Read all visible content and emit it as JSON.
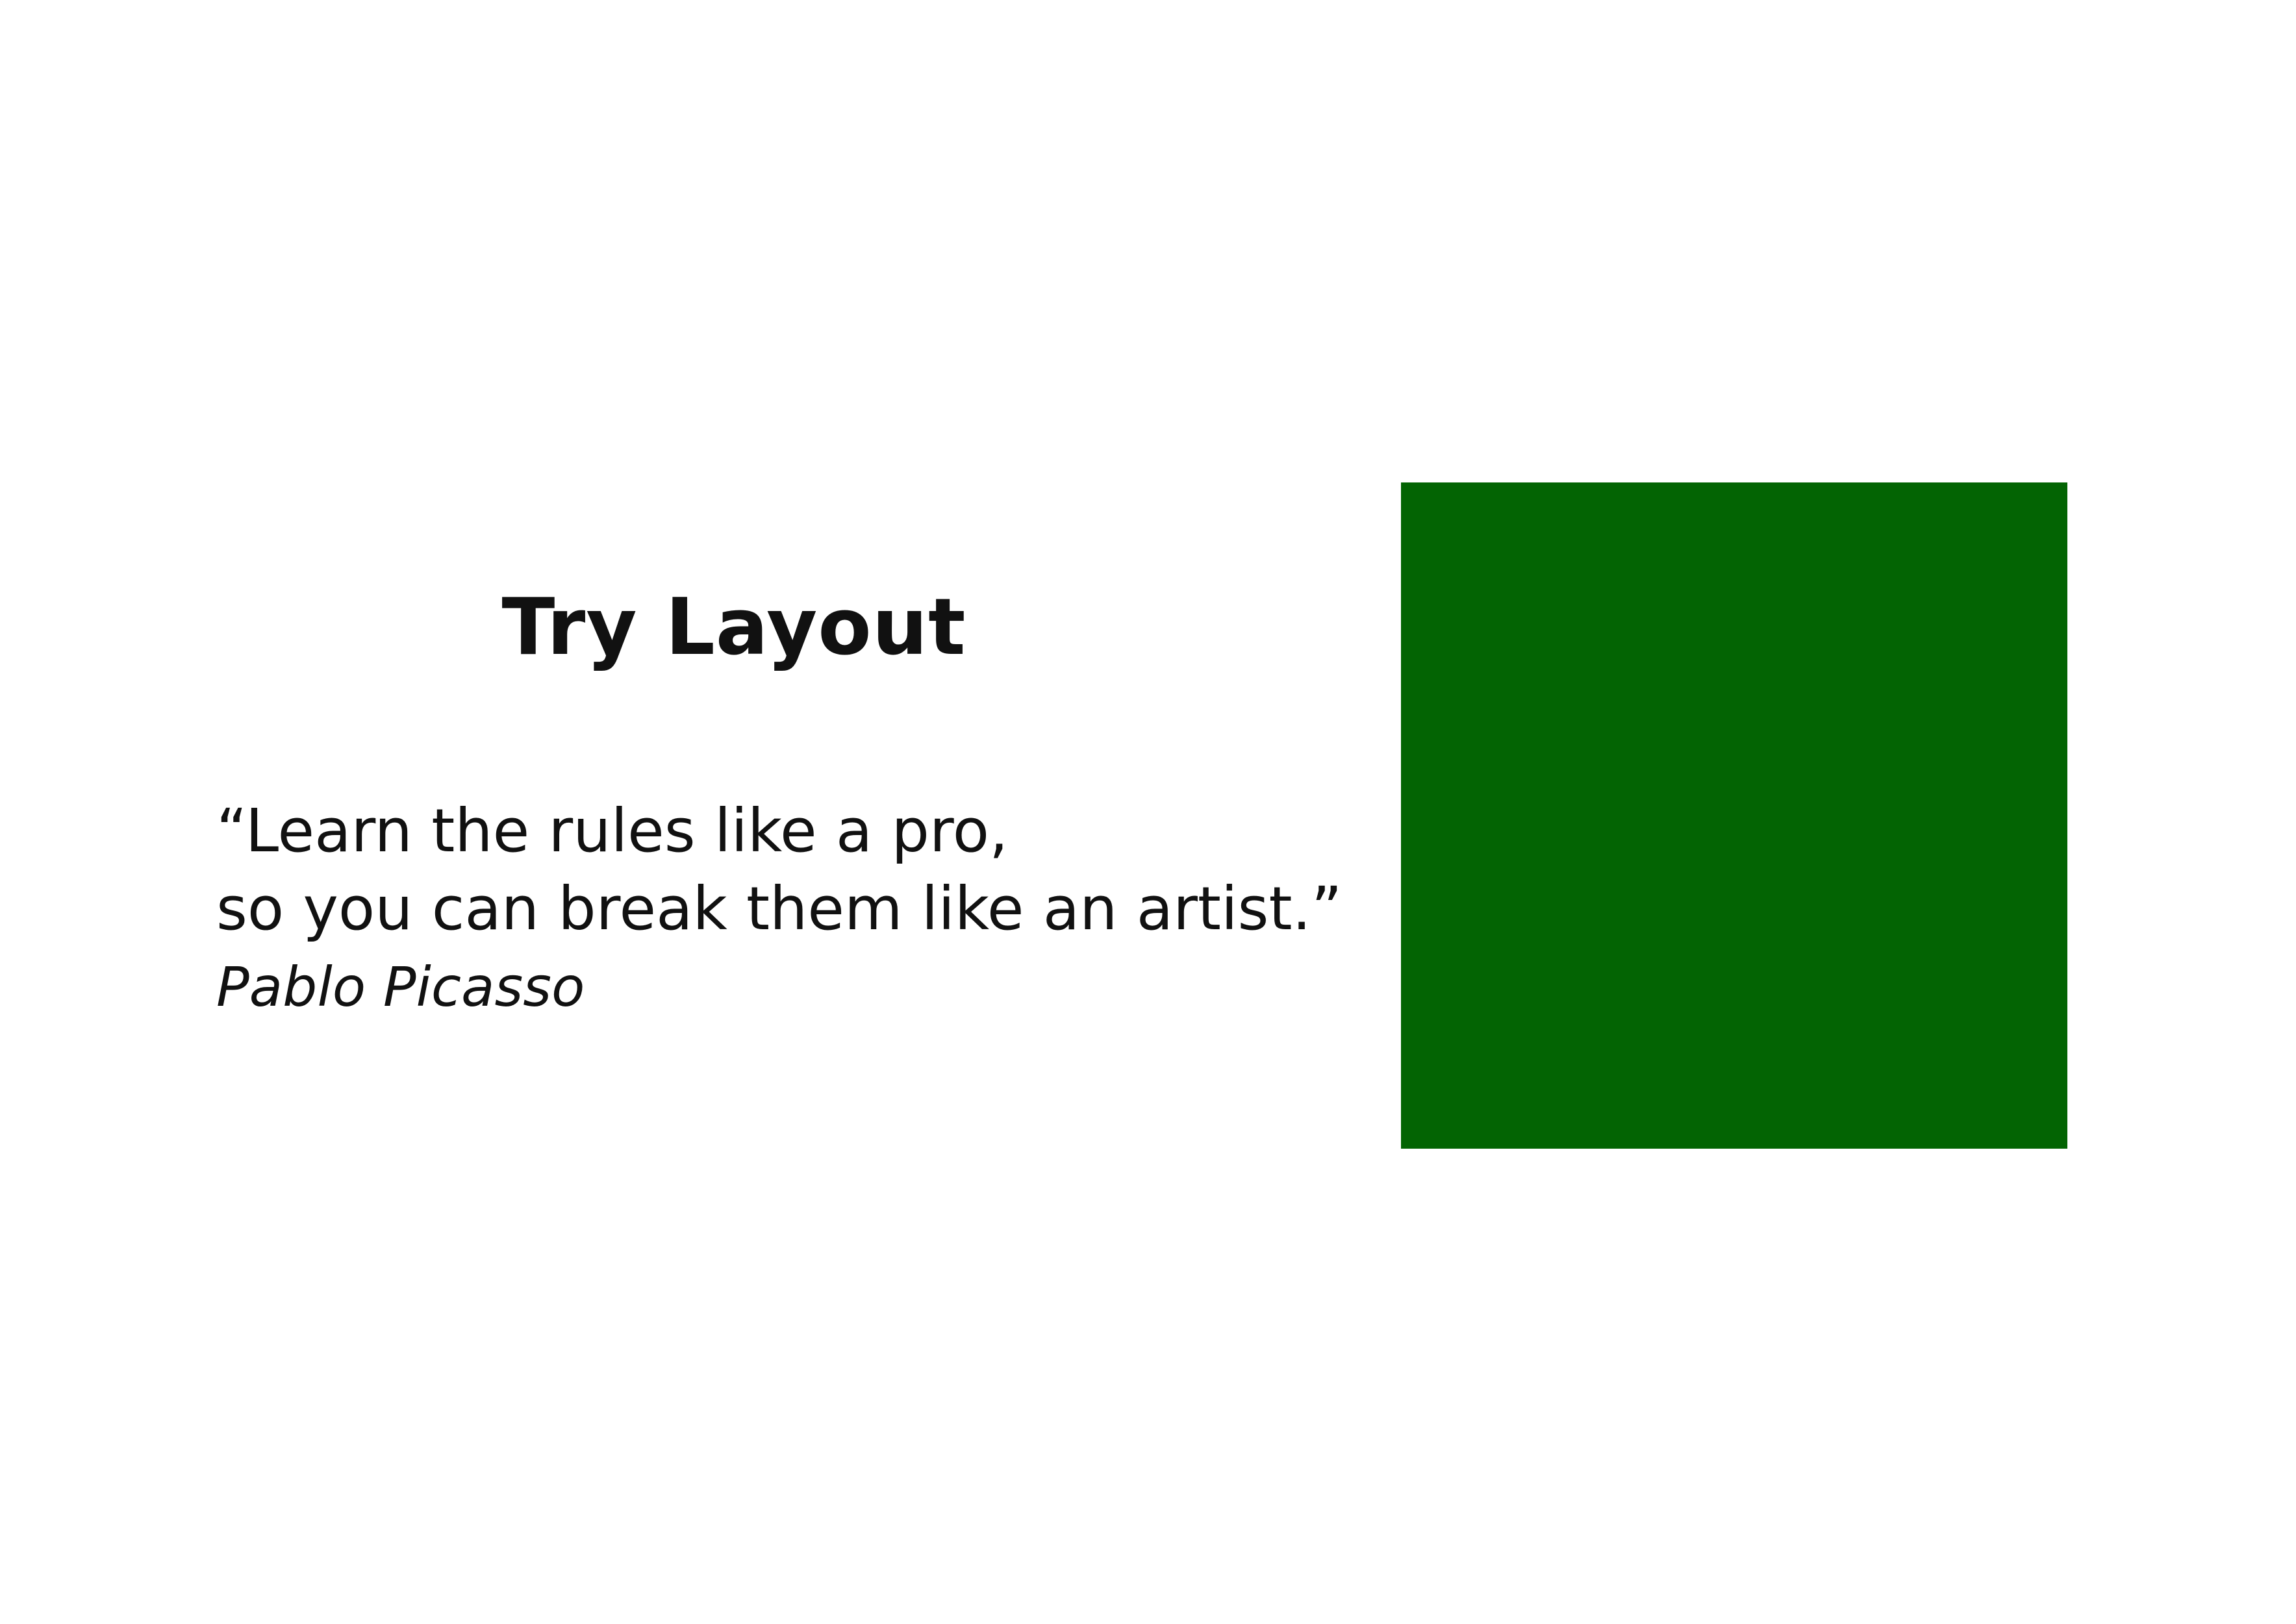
{
  "slide": {
    "title": "Try Layout",
    "quote": {
      "line1": "“Learn the rules like a pro,",
      "line2": "so you can break them like an artist.”",
      "author": "Pablo Picasso"
    },
    "box_color": "#036403"
  }
}
